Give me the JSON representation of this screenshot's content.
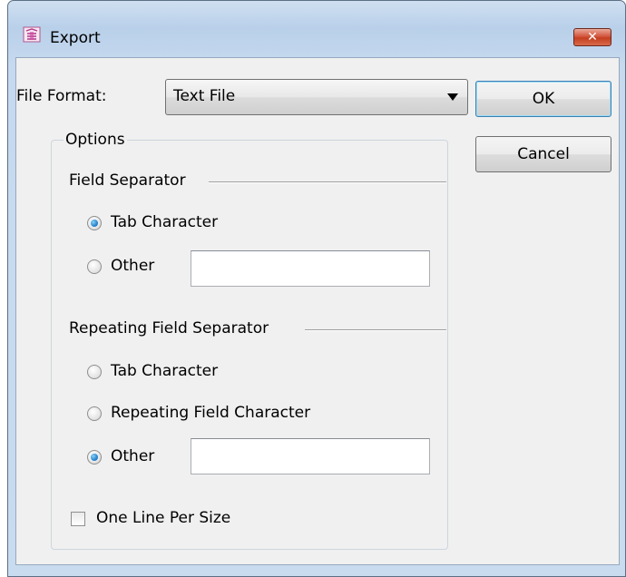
{
  "window": {
    "title": "Export",
    "icon": "export-app-icon",
    "close_label": "✕"
  },
  "file_format": {
    "label": "File Format:",
    "selected": "Text File"
  },
  "buttons": {
    "ok": "OK",
    "cancel": "Cancel"
  },
  "options": {
    "legend": "Options",
    "field_separator": {
      "heading": "Field Separator",
      "options": [
        {
          "label": "Tab Character",
          "checked": true
        },
        {
          "label": "Other",
          "checked": false,
          "value": ""
        }
      ]
    },
    "repeating_field_separator": {
      "heading": "Repeating Field Separator",
      "options": [
        {
          "label": "Tab Character",
          "checked": false
        },
        {
          "label": "Repeating Field Character",
          "checked": false
        },
        {
          "label": "Other",
          "checked": true,
          "value": ""
        }
      ]
    },
    "one_line_per_size": {
      "label": "One Line Per Size",
      "checked": false
    }
  },
  "colors": {
    "title_gradient": "#b9d0ea",
    "client_background": "#f0f0f0",
    "close_button": "#c53f22",
    "radio_dot": "#2c8ad3"
  }
}
